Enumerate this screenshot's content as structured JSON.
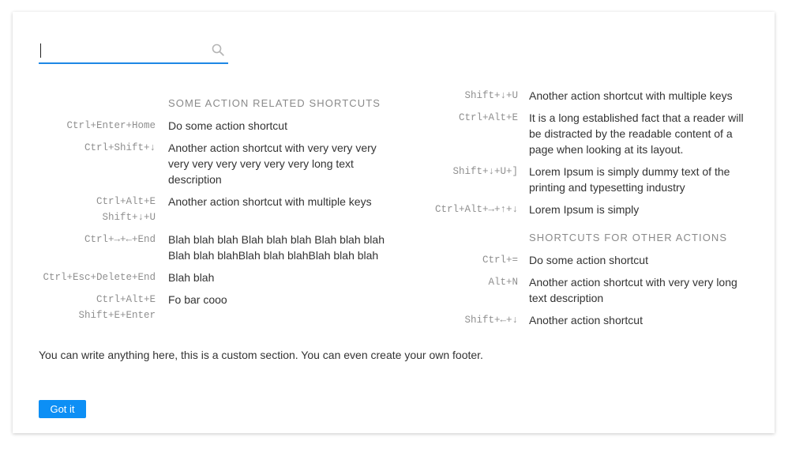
{
  "search": {
    "value": "",
    "placeholder": ""
  },
  "left": {
    "section_title": "SOME ACTION RELATED SHORTCUTS",
    "shortcuts": [
      {
        "keys": [
          "Ctrl+Enter+Home"
        ],
        "desc": "Do some action shortcut"
      },
      {
        "keys": [
          "Ctrl+Shift+↓"
        ],
        "desc": "Another action shortcut with very very very very very very very very very long text description"
      },
      {
        "keys": [
          "Ctrl+Alt+E",
          "Shift+↓+U"
        ],
        "desc": "Another action shortcut with multiple keys"
      },
      {
        "keys": [
          "Ctrl+→+←+End"
        ],
        "desc": "Blah blah blah Blah blah blah Blah blah blah Blah blah blahBlah blah blahBlah blah blah"
      },
      {
        "keys": [
          "Ctrl+Esc+Delete+End"
        ],
        "desc": "Blah blah"
      },
      {
        "keys": [
          "Ctrl+Alt+E",
          "Shift+E+Enter"
        ],
        "desc": "Fo bar cooo"
      }
    ]
  },
  "right": {
    "shortcuts": [
      {
        "keys": [
          "Shift+↓+U"
        ],
        "desc": "Another action shortcut with multiple keys"
      },
      {
        "keys": [
          "Ctrl+Alt+E"
        ],
        "desc": "It is a long established fact that a reader will be distracted by the readable content of a page when looking at its layout."
      },
      {
        "keys": [
          "Shift+↓+U+]"
        ],
        "desc": "Lorem Ipsum is simply dummy text of the printing and typesetting industry"
      },
      {
        "keys": [
          "Ctrl+Alt+→+↑+↓"
        ],
        "desc": "Lorem Ipsum is simply"
      }
    ],
    "section_title": "SHORTCUTS FOR OTHER ACTIONS",
    "other_shortcuts": [
      {
        "keys": [
          "Ctrl+="
        ],
        "desc": "Do some action shortcut"
      },
      {
        "keys": [
          "Alt+N"
        ],
        "desc": "Another action shortcut with very very long text description"
      },
      {
        "keys": [
          "Shift+←+↓"
        ],
        "desc": "Another action shortcut"
      }
    ]
  },
  "footer": {
    "text": "You can write anything here, this is a custom section. You can even create your own footer.",
    "button_label": "Got it"
  },
  "colors": {
    "accent": "#1e88e5",
    "button": "#0d8ff5",
    "muted": "#8a8a8a"
  }
}
